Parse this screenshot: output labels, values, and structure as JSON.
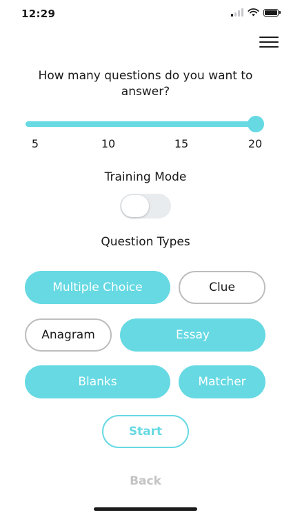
{
  "status_bar": {
    "time": "12:29",
    "icons": [
      "signal-icon",
      "wifi-icon",
      "battery-icon"
    ]
  },
  "header": {
    "menu_icon": "hamburger-menu-icon"
  },
  "question_count": {
    "heading": "How many questions do you want to answer?",
    "ticks": [
      "5",
      "10",
      "15",
      "20"
    ],
    "min": 5,
    "max": 20,
    "value": 20
  },
  "training_mode": {
    "heading": "Training Mode",
    "enabled": false
  },
  "question_types": {
    "heading": "Question Types",
    "items": [
      {
        "label": "Multiple Choice",
        "selected": true
      },
      {
        "label": "Clue",
        "selected": false
      },
      {
        "label": "Anagram",
        "selected": false
      },
      {
        "label": "Essay",
        "selected": true
      },
      {
        "label": "Blanks",
        "selected": true
      },
      {
        "label": "Matcher",
        "selected": true
      }
    ]
  },
  "actions": {
    "start_label": "Start",
    "back_label": "Back"
  },
  "colors": {
    "accent": "#66d9e3",
    "inactive_border": "#bdbdbd",
    "muted_text": "#c4c4c4"
  }
}
